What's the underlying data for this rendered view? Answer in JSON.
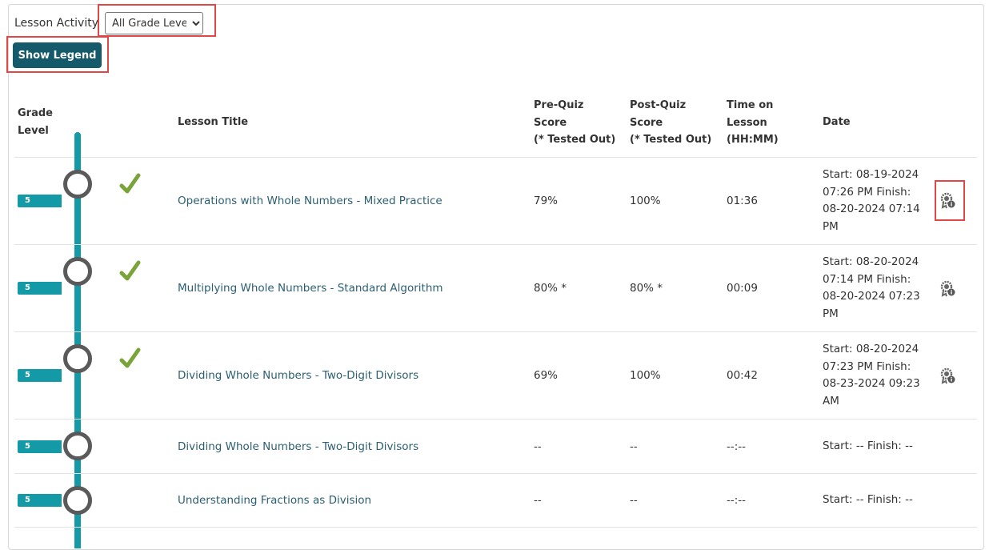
{
  "filter": {
    "label": "Lesson Activity",
    "selected": "All Grade Levels",
    "options": [
      "All Grade Levels"
    ]
  },
  "legend_button": "Show Legend",
  "headers": {
    "grade_level": [
      "Grade",
      "Level"
    ],
    "lesson_title": "Lesson Title",
    "pre_quiz": [
      "Pre-Quiz",
      "Score",
      "(* Tested Out)"
    ],
    "post_quiz": [
      "Post-Quiz",
      "Score",
      "(* Tested Out)"
    ],
    "time_on_lesson": [
      "Time on",
      "Lesson",
      "(HH:MM)"
    ],
    "date": "Date"
  },
  "rows": [
    {
      "grade": "5",
      "completed": true,
      "title": "Operations with Whole Numbers - Mixed Practice",
      "pre": "79%",
      "post": "100%",
      "time": "01:36",
      "date": [
        "Start: 08-19-2024",
        "07:26 PM Finish:",
        "08-20-2024 07:14",
        "PM"
      ],
      "award": true
    },
    {
      "grade": "5",
      "completed": true,
      "title": "Multiplying Whole Numbers - Standard Algorithm",
      "pre": "80% *",
      "post": "80% *",
      "time": "00:09",
      "date": [
        "Start: 08-20-2024",
        "07:14 PM Finish:",
        "08-20-2024 07:23",
        "PM"
      ],
      "award": true
    },
    {
      "grade": "5",
      "completed": true,
      "title": "Dividing Whole Numbers - Two-Digit Divisors",
      "pre": "69%",
      "post": "100%",
      "time": "00:42",
      "date": [
        "Start: 08-20-2024",
        "07:23 PM Finish:",
        "08-23-2024 09:23",
        "AM"
      ],
      "award": true
    },
    {
      "grade": "5",
      "completed": false,
      "title": "Dividing Whole Numbers - Two-Digit Divisors",
      "pre": "--",
      "post": "--",
      "time": "--:--",
      "date": [
        "Start: -- Finish: --"
      ],
      "award": false
    },
    {
      "grade": "5",
      "completed": false,
      "title": "Understanding Fractions as Division",
      "pre": "--",
      "post": "--",
      "time": "--:--",
      "date": [
        "Start: -- Finish: --"
      ],
      "award": false
    }
  ],
  "icons": {
    "check": "check-icon",
    "award": "award-info-icon",
    "node": "timeline-node"
  },
  "colors": {
    "teal": "#1499a6",
    "button": "#145a6a",
    "check": "#7aa33a",
    "highlight": "#e04848",
    "link": "#2b5f72"
  }
}
